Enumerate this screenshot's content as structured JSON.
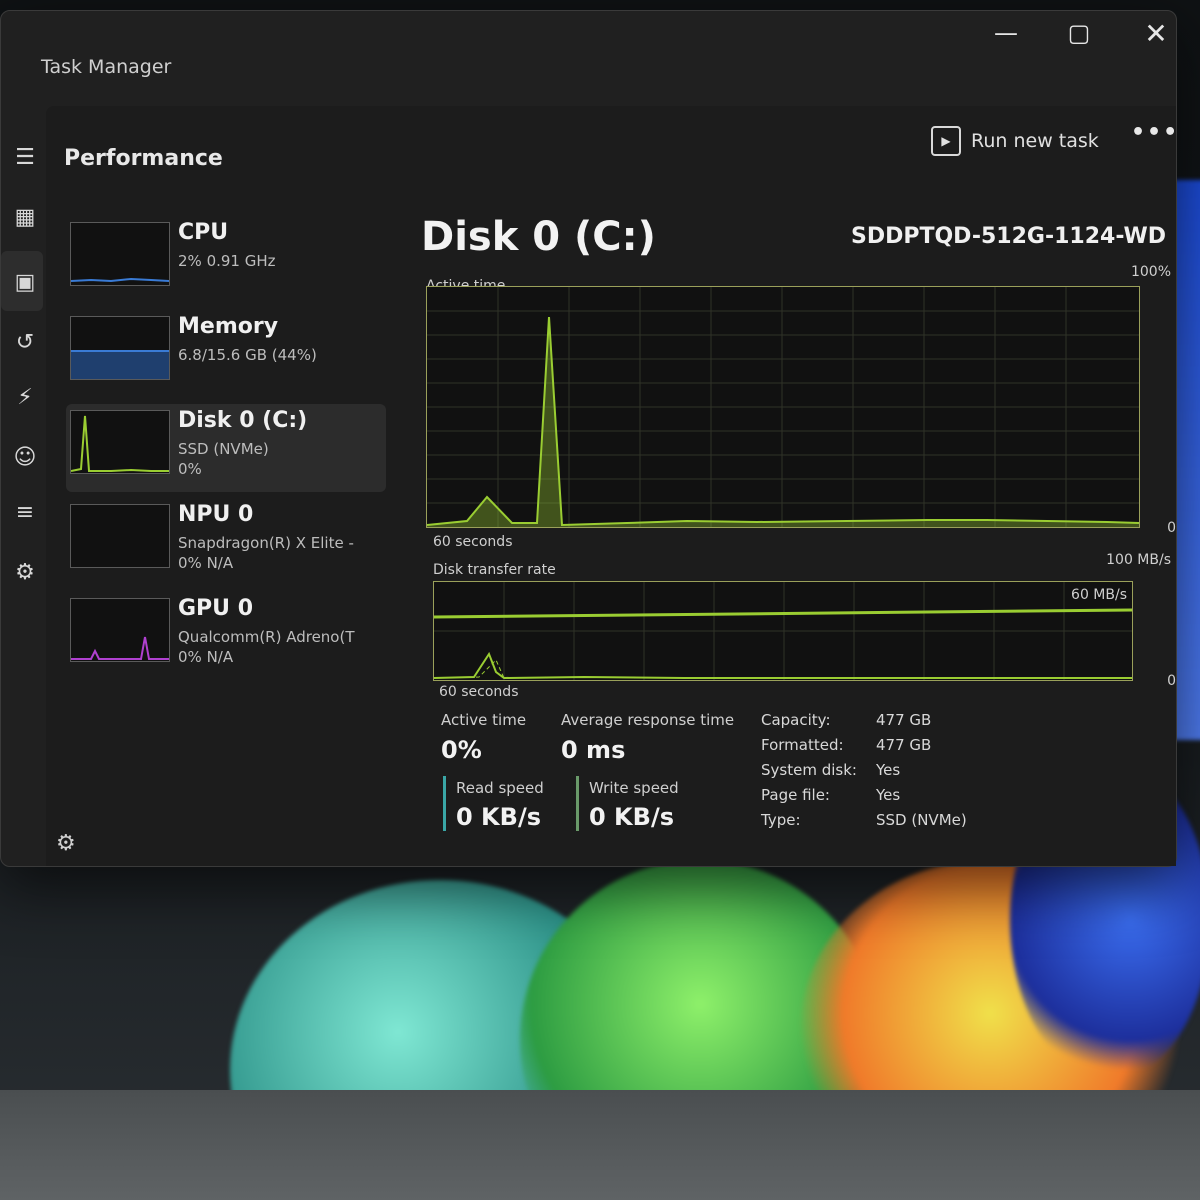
{
  "window": {
    "title": "Task Manager",
    "controls": {
      "minimize": "—",
      "maximize": "▢",
      "close": "✕"
    }
  },
  "header": {
    "page_title": "Performance",
    "run_new_task": "Run new task",
    "more": "•••"
  },
  "devices": [
    {
      "name": "CPU",
      "line1": "2% 0.91 GHz",
      "line2": "",
      "active": false
    },
    {
      "name": "Memory",
      "line1": "6.8/15.6 GB (44%)",
      "line2": "",
      "active": false
    },
    {
      "name": "Disk 0 (C:)",
      "line1": "SSD (NVMe)",
      "line2": "0%",
      "active": true
    },
    {
      "name": "NPU 0",
      "line1": "Snapdragon(R) X Elite -",
      "line2": "0% N/A",
      "active": false
    },
    {
      "name": "GPU 0",
      "line1": "Qualcomm(R) Adreno(T",
      "line2": "0% N/A",
      "active": false
    }
  ],
  "disk": {
    "title": "Disk 0 (C:)",
    "model": "SDDPTQD-512G-1124-WD",
    "active_time_graph": {
      "label": "Active time",
      "max_label": "100%",
      "min_label": "0",
      "span_label": "60 seconds"
    },
    "transfer_graph": {
      "label": "Disk transfer rate",
      "max_label": "100 MB/s",
      "ref_label": "60 MB/s",
      "min_label": "0",
      "span_label": "60 seconds"
    },
    "stats": {
      "active_time_label": "Active time",
      "active_time_value": "0%",
      "avg_response_label": "Average response time",
      "avg_response_value": "0 ms",
      "read_speed_label": "Read speed",
      "read_speed_value": "0 KB/s",
      "write_speed_label": "Write speed",
      "write_speed_value": "0 KB/s"
    },
    "properties": [
      {
        "key": "Capacity:",
        "value": "477 GB"
      },
      {
        "key": "Formatted:",
        "value": "477 GB"
      },
      {
        "key": "System disk:",
        "value": "Yes"
      },
      {
        "key": "Page file:",
        "value": "Yes"
      },
      {
        "key": "Type:",
        "value": "SSD (NVMe)"
      }
    ]
  },
  "colors": {
    "accent_disk": "#9acd32",
    "accent_memory": "#3a7bd5",
    "accent_gpu": "#b040d0",
    "read_bar": "#3aa6a6",
    "write_bar": "#6a9a6a"
  },
  "rail_icons": [
    "hamburger-icon",
    "processes-icon",
    "performance-icon",
    "app-history-icon",
    "startup-icon",
    "users-icon",
    "details-icon",
    "services-icon"
  ]
}
